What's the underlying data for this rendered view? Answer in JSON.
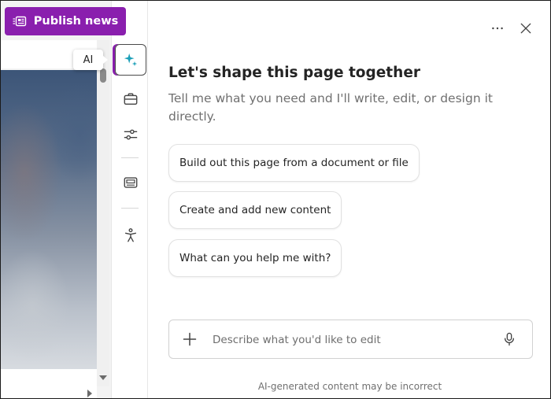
{
  "header": {
    "publish_label": "Publish news"
  },
  "tooltip": {
    "text": "AI"
  },
  "rail": {
    "items": [
      {
        "icon": "sparkle-icon",
        "active": true
      },
      {
        "icon": "briefcase-icon"
      },
      {
        "icon": "sliders-icon"
      },
      {
        "icon": "card-layout-icon"
      },
      {
        "icon": "accessibility-icon"
      }
    ]
  },
  "panel": {
    "title": "Let's shape this page together",
    "subtitle": "Tell me what you need and I'll write, edit, or design it directly.",
    "suggestions": [
      "Build out this page from a document or file",
      "Create and add new content",
      "What can you help me with?"
    ],
    "composer": {
      "placeholder": "Describe what you'd like to edit"
    },
    "disclaimer": "AI-generated content may be incorrect"
  },
  "colors": {
    "accent": "#8a1fae",
    "sparkle": "#1b9fb8"
  }
}
